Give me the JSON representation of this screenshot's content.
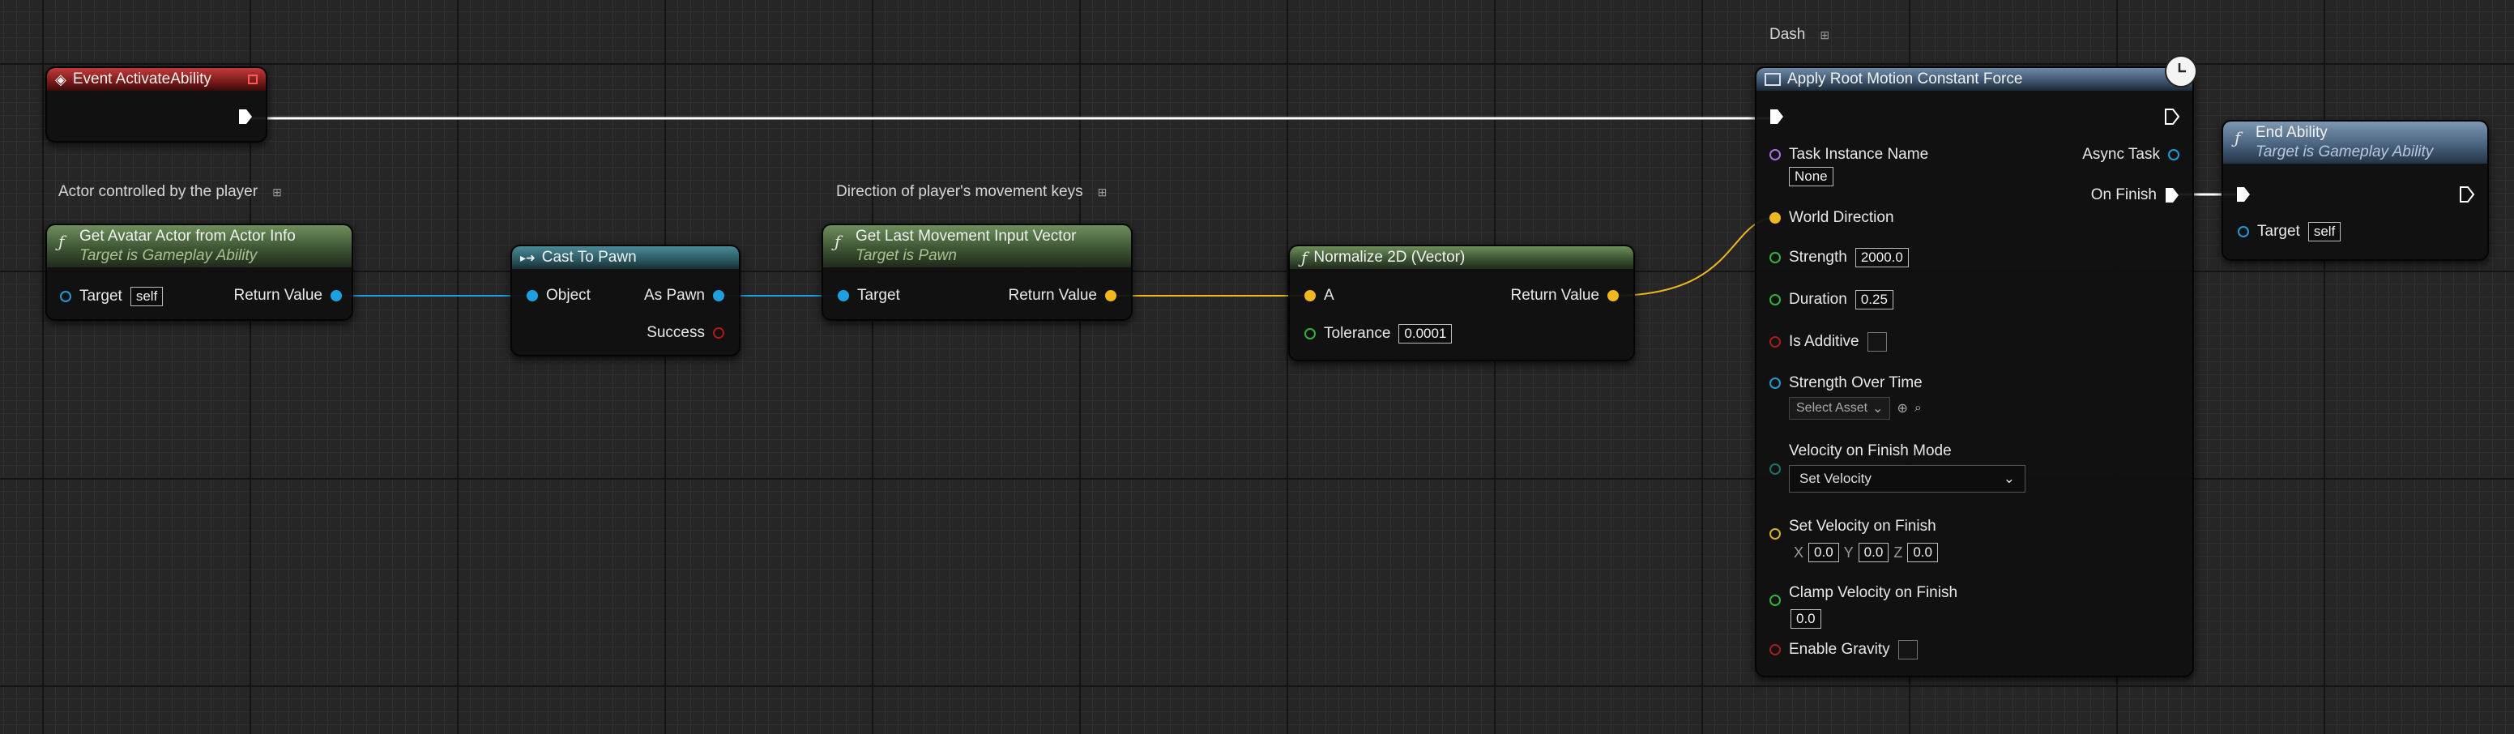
{
  "graph": {
    "comments": {
      "actor_comment": "Actor controlled by the player",
      "direction_comment": "Direction of player's movement keys",
      "dash_comment": "Dash"
    },
    "event_node": {
      "title": "Event ActivateAbility"
    },
    "get_avatar": {
      "title": "Get Avatar Actor from Actor Info",
      "subtitle": "Target is Gameplay Ability",
      "target_label": "Target",
      "target_value": "self",
      "return_label": "Return Value"
    },
    "cast_to_pawn": {
      "title": "Cast To Pawn",
      "object_label": "Object",
      "as_pawn_label": "As Pawn",
      "success_label": "Success"
    },
    "get_last_movement": {
      "title": "Get Last Movement Input Vector",
      "subtitle": "Target is Pawn",
      "target_label": "Target",
      "return_label": "Return Value"
    },
    "normalize": {
      "title": "Normalize 2D (Vector)",
      "a_label": "A",
      "return_label": "Return Value",
      "tolerance_label": "Tolerance",
      "tolerance_value": "0.0001"
    },
    "apply_root_motion": {
      "title": "Apply Root Motion Constant Force",
      "task_instance_label": "Task Instance Name",
      "task_instance_value": "None",
      "async_task_label": "Async Task",
      "on_finish_label": "On Finish",
      "world_direction_label": "World Direction",
      "strength_label": "Strength",
      "strength_value": "2000.0",
      "duration_label": "Duration",
      "duration_value": "0.25",
      "is_additive_label": "Is Additive",
      "strength_over_time_label": "Strength Over Time",
      "select_asset_label": "Select Asset",
      "velocity_mode_label": "Velocity on Finish Mode",
      "velocity_mode_value": "Set Velocity",
      "set_velocity_label": "Set Velocity on Finish",
      "x_label": "X",
      "x_value": "0.0",
      "y_label": "Y",
      "y_value": "0.0",
      "z_label": "Z",
      "z_value": "0.0",
      "clamp_label": "Clamp Velocity on Finish",
      "clamp_value": "0.0",
      "enable_gravity_label": "Enable Gravity"
    },
    "end_ability": {
      "title": "End Ability",
      "subtitle": "Target is Gameplay Ability",
      "target_label": "Target",
      "target_value": "self"
    }
  },
  "colors": {
    "exec_wire": "#ffffff",
    "object_wire": "#1ea0e0",
    "vector_wire": "#f0b71f"
  },
  "icons": [
    "function-icon",
    "event-icon",
    "cast-icon",
    "latent-clock-icon",
    "comment-pin-icon",
    "exec-pin-icon"
  ]
}
